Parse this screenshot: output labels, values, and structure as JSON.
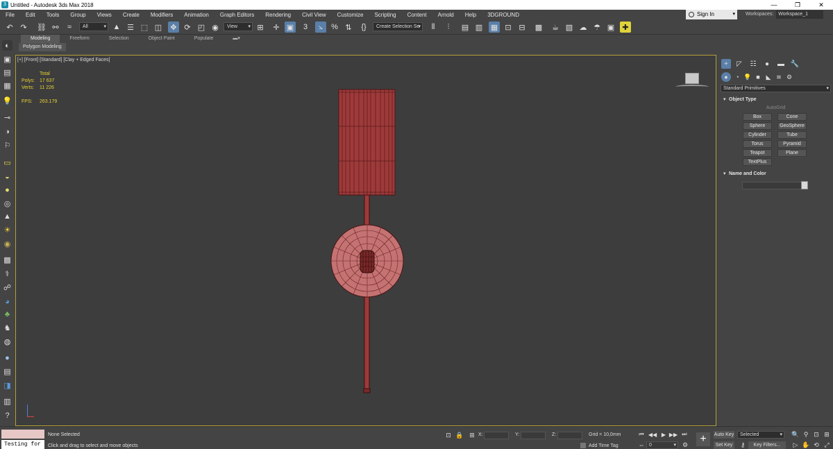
{
  "window": {
    "title": "Untitled - Autodesk 3ds Max 2018",
    "app_icon": "3"
  },
  "window_controls": {
    "minimize": "—",
    "maximize": "❐",
    "close": "✕"
  },
  "menu": [
    "File",
    "Edit",
    "Tools",
    "Group",
    "Views",
    "Create",
    "Modifiers",
    "Animation",
    "Graph Editors",
    "Rendering",
    "Civil View",
    "Customize",
    "Scripting",
    "Content",
    "Arnold",
    "Help",
    "3DGROUND"
  ],
  "signin": {
    "label": "Sign In"
  },
  "workspaces": {
    "label": "Workspaces:",
    "value": "Workspace_1"
  },
  "toolbar": {
    "selection_filter": "All",
    "ref_coord": "View",
    "named_selection": "Create Selection Se"
  },
  "ribbon": {
    "tabs": [
      "Modeling",
      "Freeform",
      "Selection",
      "Object Paint",
      "Populate"
    ],
    "active_tab": "Modeling",
    "panel_label": "Polygon Modeling"
  },
  "viewport": {
    "label": "[+] [Front] [Standard] [Clay + Edged Faces]",
    "stats": {
      "header": "Total",
      "polys_label": "Polys:",
      "polys": "17 637",
      "verts_label": "Verts:",
      "verts": "11 226",
      "fps_label": "FPS:",
      "fps": "263.179"
    },
    "model_color": "#9e3a3a"
  },
  "command_panel": {
    "category": "Standard Primitives",
    "object_type_title": "Object Type",
    "autogrid": "AutoGrid",
    "buttons": [
      "Box",
      "Cone",
      "Sphere",
      "GeoSphere",
      "Cylinder",
      "Tube",
      "Torus",
      "Pyramid",
      "Teapot",
      "Plane",
      "TextPlus"
    ],
    "name_color_title": "Name and Color"
  },
  "status": {
    "maxscript_text": "Testing for :",
    "selection": "None Selected",
    "prompt": "Click and drag to select and move objects",
    "x_label": "X:",
    "y_label": "Y:",
    "z_label": "Z:",
    "grid": "Grid = 10,0mm",
    "add_time_tag": "Add Time Tag",
    "frame": "0",
    "auto_key": "Auto Key",
    "set_key": "Set Key",
    "selected_dd": "Selected",
    "key_filters": "Key Filters..."
  }
}
